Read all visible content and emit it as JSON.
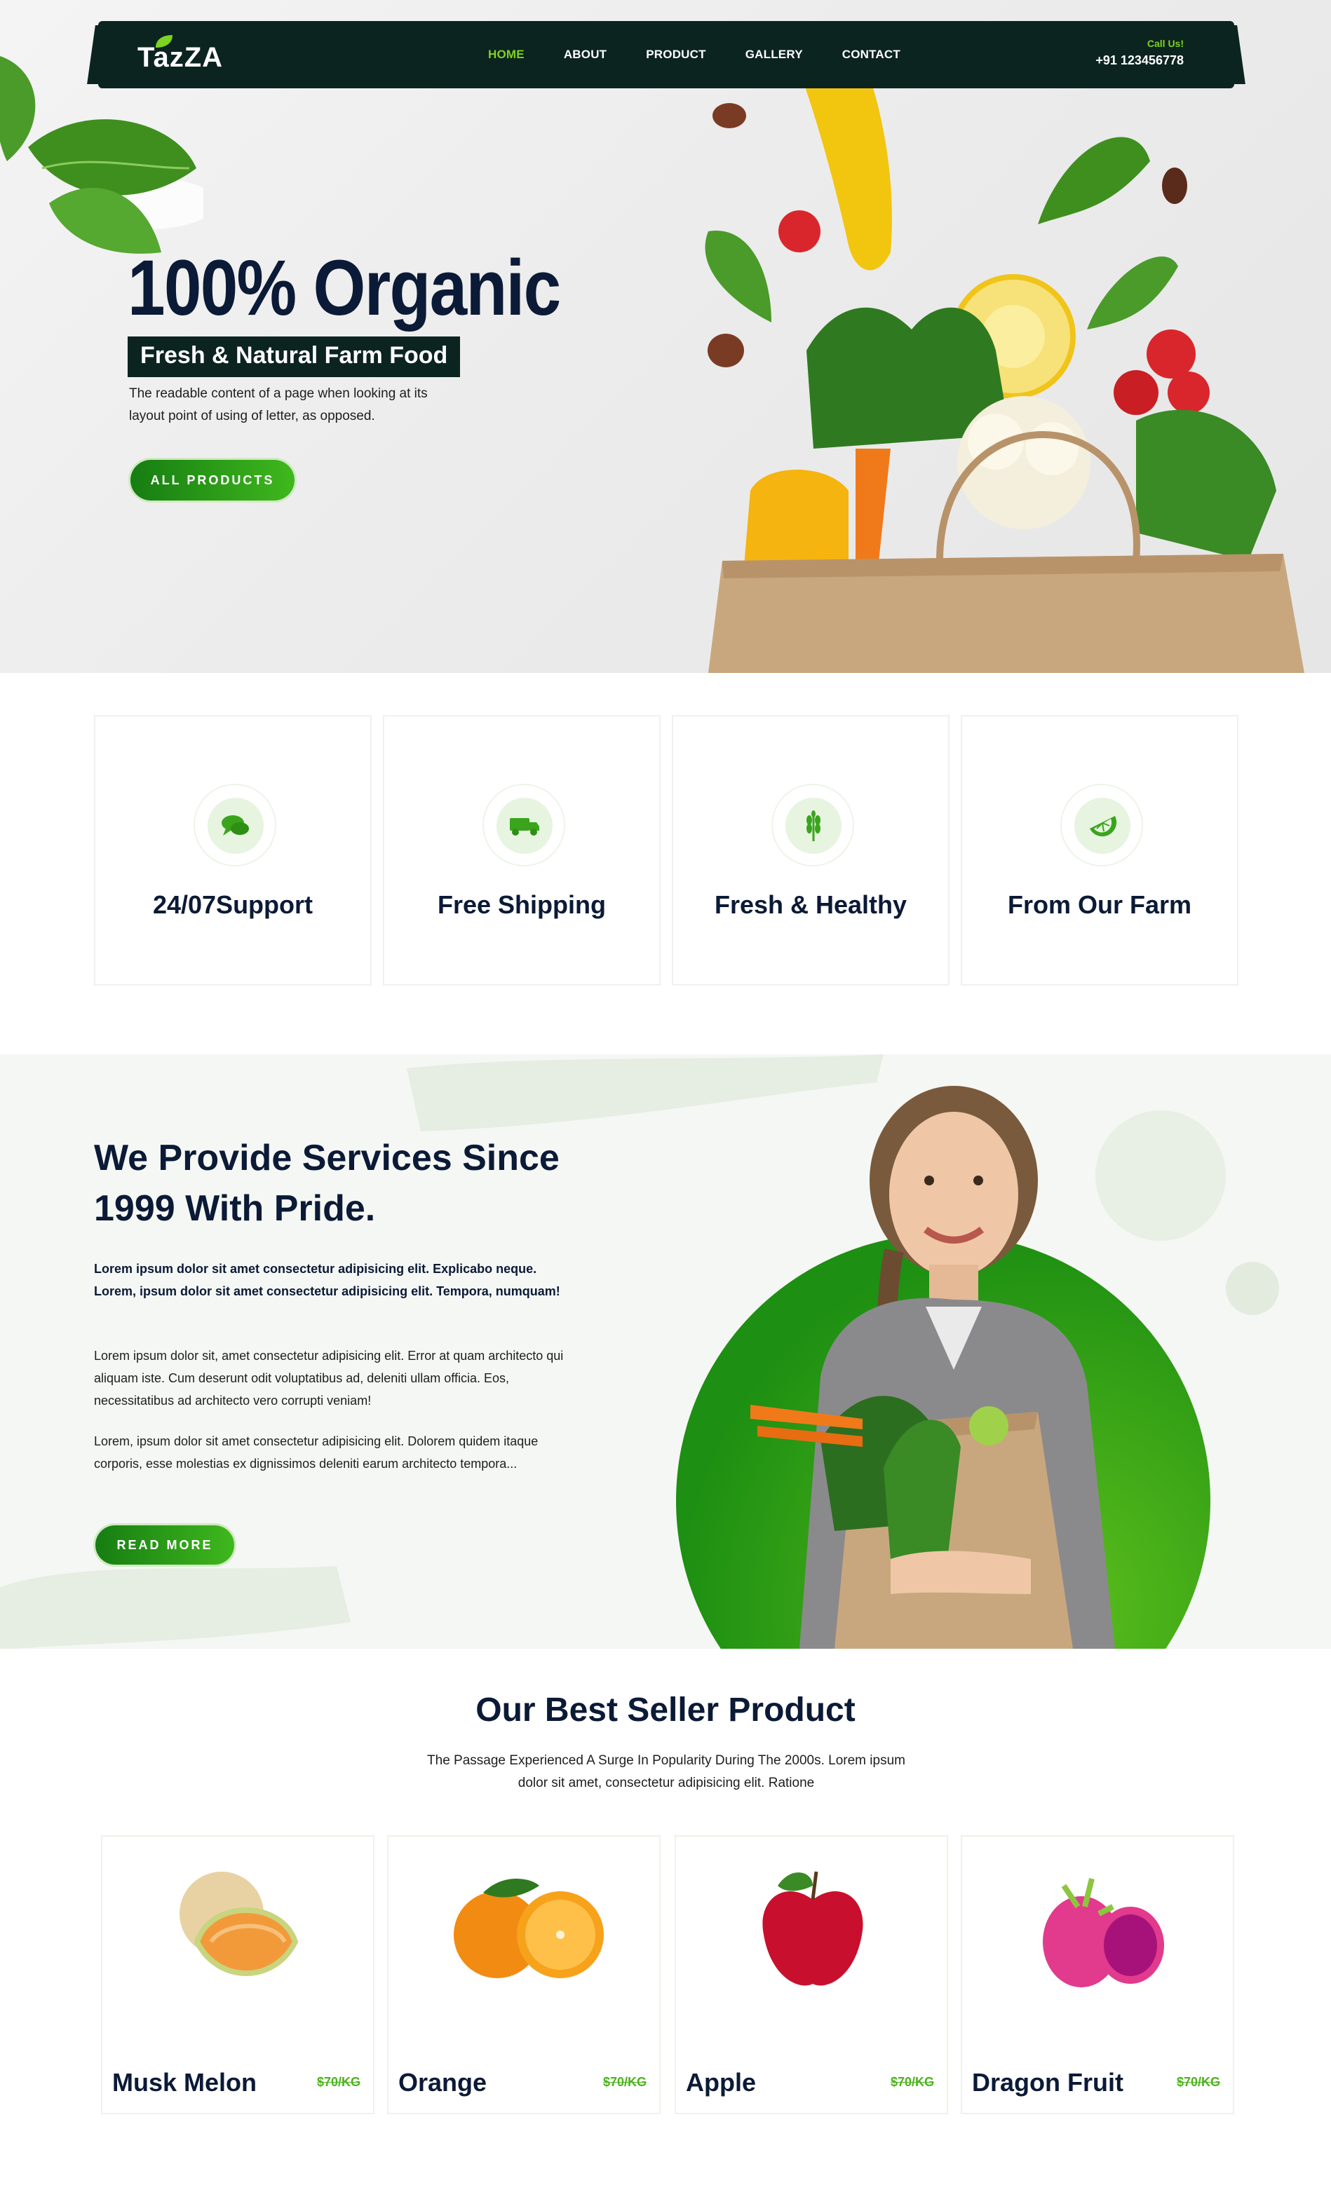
{
  "nav": {
    "logo": "TazZA",
    "items": [
      {
        "label": "HOME",
        "active": true
      },
      {
        "label": "ABOUT",
        "active": false
      },
      {
        "label": "PRODUCT",
        "active": false
      },
      {
        "label": "GALLERY",
        "active": false
      },
      {
        "label": "CONTACT",
        "active": false
      }
    ],
    "call_label": "Call Us!",
    "call_number": "+91 123456778"
  },
  "hero": {
    "title": "100% Organic",
    "tagline": "Fresh & Natural Farm Food",
    "description": "The readable content of a page when looking at its layout point of using of letter, as opposed.",
    "button": "ALL PRODUCTS"
  },
  "features": [
    {
      "title": "24/07Support",
      "icon": "chat-icon"
    },
    {
      "title": "Free Shipping",
      "icon": "truck-icon"
    },
    {
      "title": "Fresh & Healthy",
      "icon": "wheat-icon"
    },
    {
      "title": "From Our Farm",
      "icon": "lemon-slice-icon"
    }
  ],
  "about": {
    "heading": "We Provide Services Since 1999 With Pride.",
    "para_bold": "Lorem ipsum dolor sit amet consectetur adipisicing elit. Explicabo neque. Lorem, ipsum dolor sit amet consectetur adipisicing elit. Tempora, numquam!",
    "para_1": "Lorem ipsum dolor sit, amet consectetur adipisicing elit. Error at quam architecto qui aliquam iste. Cum deserunt odit voluptatibus ad, deleniti ullam officia. Eos, necessitatibus ad architecto vero corrupti veniam!",
    "para_2": "Lorem, ipsum dolor sit amet consectetur adipisicing elit. Dolorem quidem itaque corporis, esse molestias ex dignissimos deleniti earum architecto tempora...",
    "button": "READ MORE"
  },
  "products": {
    "title": "Our Best Seller Product",
    "subtitle": "The Passage Experienced A Surge In Popularity During The 2000s. Lorem ipsum dolor sit amet, consectetur adipisicing elit. Ratione",
    "items": [
      {
        "name": "Musk Melon",
        "price": "$70/KG"
      },
      {
        "name": "Orange",
        "price": "$70/KG"
      },
      {
        "name": "Apple",
        "price": "$70/KG"
      },
      {
        "name": "Dragon Fruit",
        "price": "$70/KG"
      }
    ]
  },
  "colors": {
    "dark": "#0c2420",
    "accent": "#7ed321",
    "green": "#3fb81d",
    "heading": "#0b1a36"
  }
}
